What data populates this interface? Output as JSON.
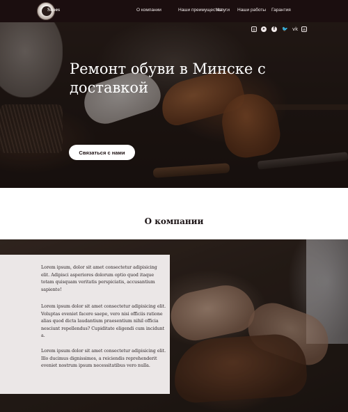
{
  "header": {
    "logo_text": "Shoes",
    "menu": [
      {
        "label": "О компании"
      },
      {
        "label": "Наши преимущества"
      },
      {
        "label": "Услуги"
      },
      {
        "label": "Наши работы"
      },
      {
        "label": "Гарантия"
      }
    ],
    "socials": [
      {
        "icon": "instagram-icon",
        "glyph": "◎"
      },
      {
        "icon": "telegram-icon",
        "glyph": "➤"
      },
      {
        "icon": "facebook-icon",
        "glyph": "f"
      },
      {
        "icon": "twitter-icon",
        "glyph": "🐦"
      },
      {
        "icon": "vk-icon",
        "glyph": "vk"
      },
      {
        "icon": "odnoklassniki-icon",
        "glyph": "ok"
      }
    ]
  },
  "hero": {
    "title": "Ремонт обуви в Минске с доставкой",
    "cta_label": "Связаться с нами"
  },
  "about": {
    "title": "О компании",
    "paragraphs": [
      "Lorem ipsum, dolor sit amet consectetur adipisicing elit. Adipisci asperiores dolorum optio quod itaque totam quisquam veritatis perspiciatis, accusantium sapiente!",
      "Lorem ipsum dolor sit amet consectetur adipisicing elit. Voluptas eveniet facere saepe, vero nisi officiis ratione alias quod dicta laudantium praesentium nihil officia nesciunt repellendus? Cupiditate eligendi cum incidunt a.",
      "Lorem ipsum dolor sit amet consectetur adipisicing elit. Illo ducimus dignissimos, a reiciendis reprehenderit eveniet nostrum ipsum necessitatibus vero nulla."
    ]
  },
  "colors": {
    "nav_bg": "#1b0e0f",
    "card_bg": "#ebe7e7",
    "text_dark": "#1c1416",
    "white": "#ffffff"
  }
}
